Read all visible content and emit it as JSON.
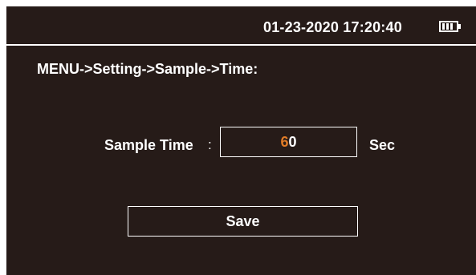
{
  "status_bar": {
    "datetime": "01-23-2020 17:20:40",
    "battery_icon": "battery-icon",
    "battery_level_bars": 3
  },
  "breadcrumb": "MENU->Setting->Sample->Time:",
  "sample_time": {
    "label": "Sample Time",
    "colon": ":",
    "value_active_digit": "6",
    "value_rest": "0",
    "unit": "Sec"
  },
  "save_button": {
    "label": "Save"
  },
  "colors": {
    "background": "#261b18",
    "foreground": "#ffffff",
    "cursor_digit": "#e07b27"
  }
}
